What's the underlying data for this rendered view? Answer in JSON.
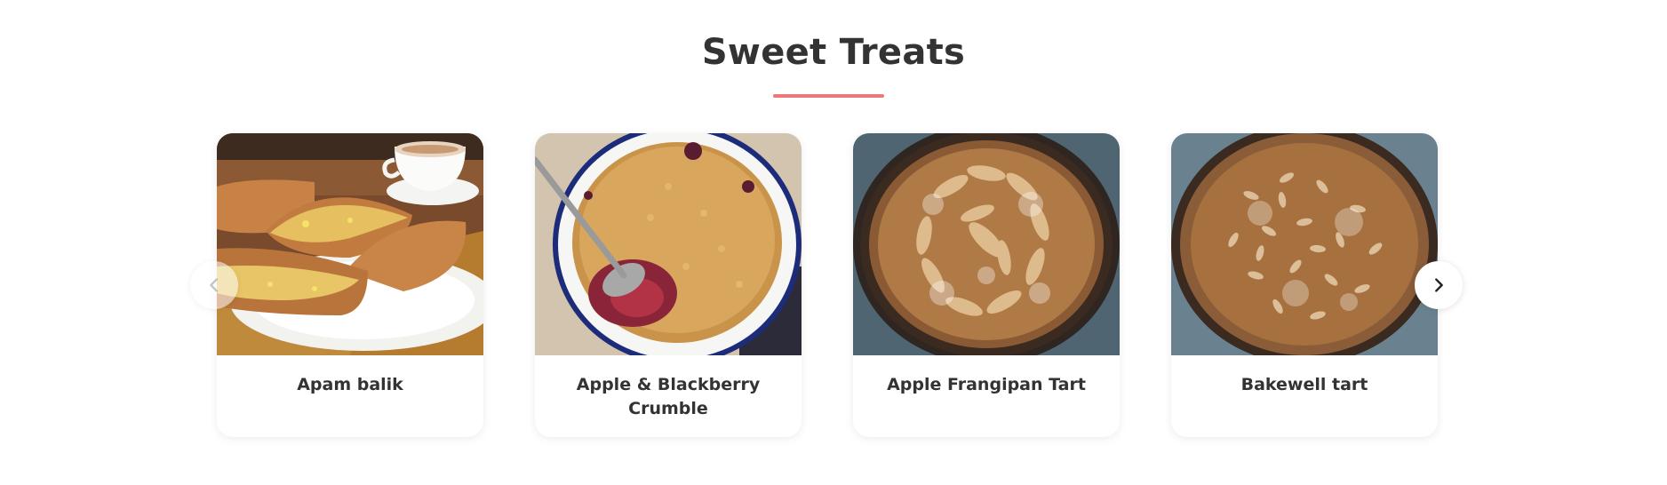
{
  "section": {
    "title": "Sweet Treats"
  },
  "accent_color": "#f07777",
  "carousel": {
    "prev_icon": "chevron-left-icon",
    "next_icon": "chevron-right-icon",
    "cards": [
      {
        "label": "Apam balik",
        "image": "apam-balik-photo"
      },
      {
        "label": "Apple & Blackberry Crumble",
        "image": "apple-blackberry-crumble-photo"
      },
      {
        "label": "Apple Frangipan Tart",
        "image": "apple-frangipan-tart-photo"
      },
      {
        "label": "Bakewell tart",
        "image": "bakewell-tart-photo"
      }
    ]
  }
}
